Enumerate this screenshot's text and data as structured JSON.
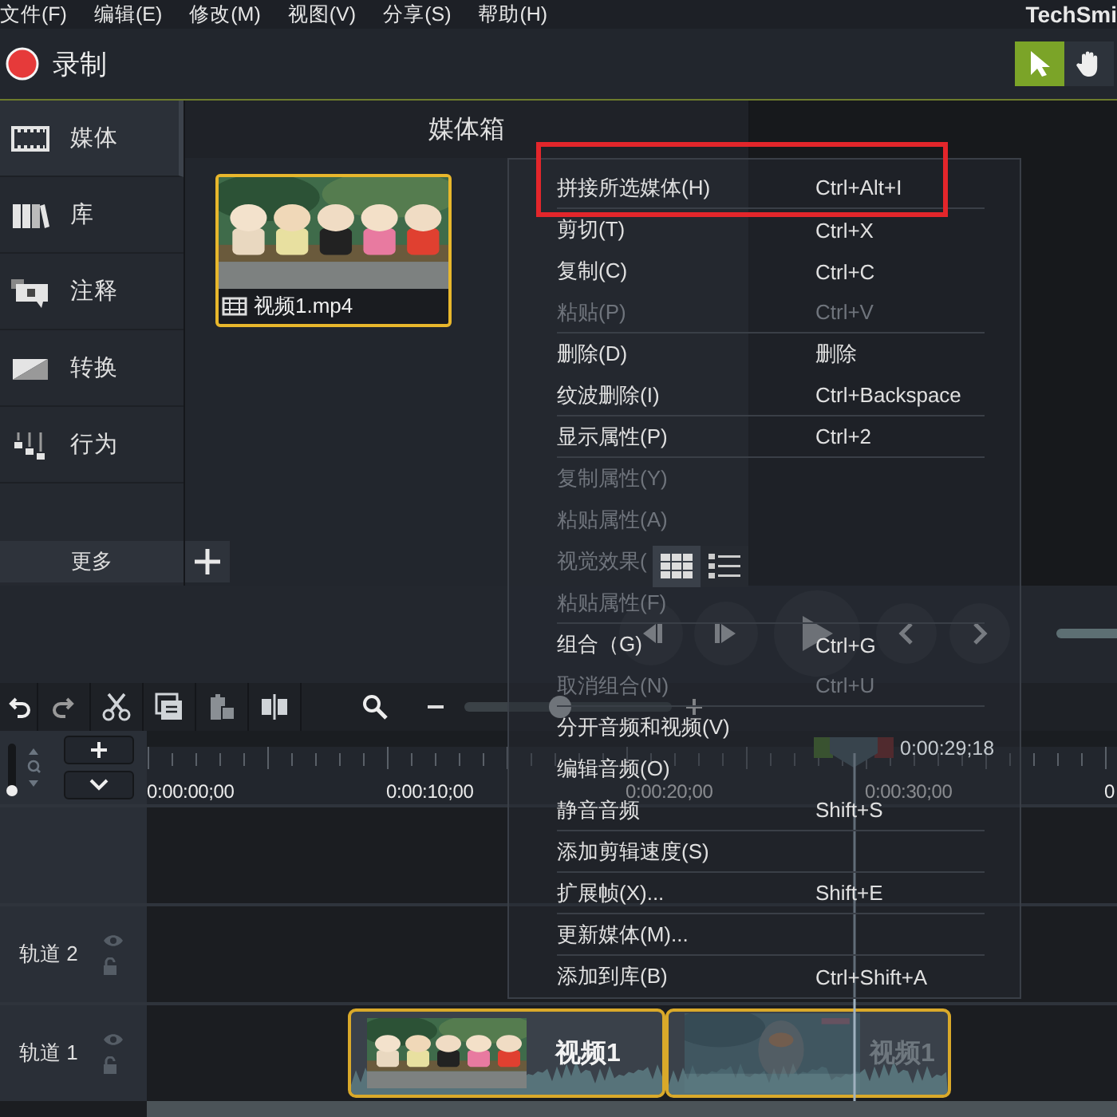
{
  "menubar": {
    "items": [
      "文件(F)",
      "编辑(E)",
      "修改(M)",
      "视图(V)",
      "分享(S)",
      "帮助(H)"
    ],
    "brand": "TechSmi"
  },
  "record": {
    "label": "录制"
  },
  "tools": [
    {
      "kind": "pointer",
      "selected": true
    },
    {
      "kind": "hand",
      "selected": false
    }
  ],
  "sidebar": {
    "items": [
      {
        "kind": "media",
        "label": "媒体",
        "selected": true
      },
      {
        "kind": "library",
        "label": "库",
        "selected": false
      },
      {
        "kind": "annotation",
        "label": "注释",
        "selected": false
      },
      {
        "kind": "transition",
        "label": "转换",
        "selected": false
      },
      {
        "kind": "behavior",
        "label": "行为",
        "selected": false
      }
    ],
    "more": "更多"
  },
  "media_bin": {
    "title": "媒体箱",
    "items": [
      {
        "name": "视频1.mp4",
        "selected": true
      }
    ],
    "view_modes": [
      {
        "kind": "grid",
        "selected": true
      },
      {
        "kind": "list",
        "selected": false
      }
    ]
  },
  "context_menu": {
    "items": [
      {
        "label": "拼接所选媒体(H)",
        "shortcut": "Ctrl+Alt+I",
        "disabled": false,
        "divider_after": true
      },
      {
        "label": "剪切(T)",
        "shortcut": "Ctrl+X",
        "disabled": false,
        "divider_after": false
      },
      {
        "label": "复制(C)",
        "shortcut": "Ctrl+C",
        "disabled": false,
        "divider_after": false
      },
      {
        "label": "粘贴(P)",
        "shortcut": "Ctrl+V",
        "disabled": true,
        "divider_after": true
      },
      {
        "label": "删除(D)",
        "shortcut": "删除",
        "disabled": false,
        "divider_after": false
      },
      {
        "label": "纹波删除(I)",
        "shortcut": "Ctrl+Backspace",
        "disabled": false,
        "divider_after": true
      },
      {
        "label": "显示属性(P)",
        "shortcut": "Ctrl+2",
        "disabled": false,
        "divider_after": true
      },
      {
        "label": "复制属性(Y)",
        "disabled": true,
        "divider_after": false
      },
      {
        "label": "粘贴属性(A)",
        "disabled": true,
        "divider_after": false
      },
      {
        "label": "视觉效果(",
        "disabled": true,
        "divider_after": false
      },
      {
        "label": "粘贴属性(F)",
        "disabled": true,
        "divider_after": true
      },
      {
        "label": "组合（G)",
        "shortcut": "Ctrl+G",
        "disabled": false,
        "divider_after": false
      },
      {
        "label": "取消组合(N)",
        "shortcut": "Ctrl+U",
        "disabled": true,
        "divider_after": true
      },
      {
        "label": "分开音频和视频(V)",
        "disabled": false,
        "divider_after": false
      },
      {
        "label": "编辑音频(O)",
        "disabled": false,
        "divider_after": false
      },
      {
        "label": "静音音频",
        "shortcut": "Shift+S",
        "disabled": false,
        "divider_after": true
      },
      {
        "label": "添加剪辑速度(S)",
        "disabled": false,
        "divider_after": true
      },
      {
        "label": "扩展帧(X)...",
        "shortcut": "Shift+E",
        "disabled": false,
        "divider_after": true
      },
      {
        "label": "更新媒体(M)...",
        "disabled": false,
        "divider_after": true
      },
      {
        "label": "添加到库(B)",
        "shortcut": "Ctrl+Shift+A",
        "disabled": false,
        "divider_after": false
      }
    ]
  },
  "player": {
    "scrub": {
      "level": 1
    }
  },
  "timeline": {
    "zoom": {
      "level": 0.46
    },
    "volume": {
      "level": 0
    },
    "ruler": [
      "0:00:00;00",
      "0:00:10;00",
      "0:00:20;00",
      "0:00:30;00",
      "0"
    ],
    "playhead": {
      "time": "0:00:29;18"
    },
    "tracks": [
      {
        "name": "轨道 2"
      },
      {
        "name": "轨道 1",
        "clips": [
          {
            "label": "视频1",
            "dimmed": false
          },
          {
            "label": "视频1",
            "dimmed": true
          }
        ]
      }
    ]
  }
}
